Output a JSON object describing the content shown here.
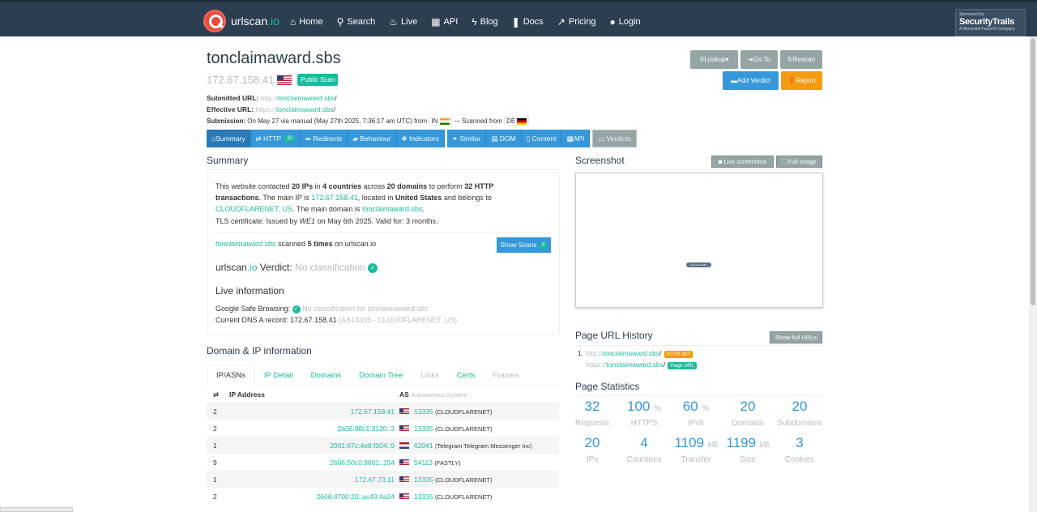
{
  "nav": {
    "brand_name": "urlscan",
    "brand_tld": ".io",
    "items": [
      {
        "label": "Home",
        "icon": "home-icon"
      },
      {
        "label": "Search",
        "icon": "search-icon"
      },
      {
        "label": "Live",
        "icon": "flame-icon"
      },
      {
        "label": "API",
        "icon": "api-icon"
      },
      {
        "label": "Blog",
        "icon": "bolt-icon"
      },
      {
        "label": "Docs",
        "icon": "bookmark-icon"
      },
      {
        "label": "Pricing",
        "icon": "external-link-icon"
      },
      {
        "label": "Login",
        "icon": "user-icon"
      }
    ],
    "sponsor_small": "Sponsored by",
    "sponsor_name": "SecurityTrails",
    "sponsor_sub": "A Recorded Future® Company"
  },
  "header": {
    "domain": "tonclaimaward.sbs",
    "ip": "172.67.158.41",
    "public_badge": "Public Scan",
    "submitted_label": "Submitted URL:",
    "submitted_scheme": "http://",
    "submitted_host": "tonclaimaward.sbs",
    "submitted_path": "/",
    "effective_label": "Effective URL:",
    "effective_scheme": "https://",
    "effective_host": "tonclaimaward.sbs",
    "effective_path": "/",
    "submission_label": "Submission:",
    "submission_text": "On May 27 via manual (May 27th 2025, 7:36:17 am UTC) from",
    "submission_cc": "IN",
    "scanned_from_text": "— Scanned from",
    "scanned_cc": "DE"
  },
  "actions": {
    "lookup": "Lookup",
    "goto": "Go To",
    "rescan": "Rescan",
    "add_verdict": "Add Verdict",
    "report": "Report"
  },
  "tabs": {
    "summary": "Summary",
    "http": "HTTP",
    "http_count": "32",
    "redirects": "Redirects",
    "behaviour": "Behaviour",
    "indicators": "Indicators",
    "similar": "Similar",
    "dom": "DOM",
    "content": "Content",
    "api": "API",
    "verdicts": "Verdicts"
  },
  "summary": {
    "heading": "Summary",
    "t1": "This website contacted ",
    "ips": "20 IPs",
    "t2": " in ",
    "countries": "4 countries",
    "t3": " across ",
    "domains": "20 domains",
    "t4": " to perform ",
    "http_tx": "32 HTTP transactions",
    "t5": ". The main IP is ",
    "main_ip": "172.67.158.41",
    "t6": ", located in ",
    "location": "United States",
    "t7": " and belongs to ",
    "asn": "CLOUDFLARENET, US",
    "t8": ". The main domain is ",
    "main_domain": "tonclaimaward.sbs",
    "t9": ".",
    "tls_prefix": "TLS certificate: Issued by ",
    "tls_issuer": "WE1",
    "tls_suffix": " on May 6th 2025. Valid for: 3 months.",
    "scanned_domain": "tonclaimaward.sbs",
    "scanned_mid": " scanned ",
    "scanned_times": "5 times",
    "scanned_suffix": " on urlscan.io",
    "show_scans": "Show Scans",
    "show_scans_count": "5",
    "verdict_prefix": "urlscan",
    "verdict_tld": ".io",
    "verdict_label": " Verdict: ",
    "verdict_value": "No classification",
    "live_heading": "Live information",
    "gsb_label": "Google Safe Browsing: ",
    "gsb_value": "No classification for ",
    "gsb_domain": "tonclaimaward.sbs",
    "dns_label": "Current DNS A record: 172.67.158.41 ",
    "dns_as": "(AS13335 - CLOUDFLARENET, US)"
  },
  "domain_ip": {
    "heading": "Domain & IP information",
    "tabs": [
      "IP/ASNs",
      "IP Detail",
      "Domains",
      "Domain Tree",
      "Links",
      "Certs",
      "Frames"
    ],
    "col_ip": "IP Address",
    "col_as": "AS",
    "col_as_sub": "Autonomous System",
    "rows": [
      {
        "count": "2",
        "ip": "172.67.158.41",
        "flag": "US",
        "asn": "13335",
        "as_name": "(CLOUDFLARENET)"
      },
      {
        "count": "2",
        "ip": "2a06:98c1:3120::3",
        "flag": "US",
        "asn": "13335",
        "as_name": "(CLOUDFLARENET)"
      },
      {
        "count": "1",
        "ip": "2001:67c:4e8:f004::9",
        "flag": "NL",
        "asn": "62041",
        "as_name": "(Telegram Telegram Messenger Inc)"
      },
      {
        "count": "9",
        "ip": "2606:50c0:8001::154",
        "flag": "US",
        "asn": "54113",
        "as_name": "(FASTLY)"
      },
      {
        "count": "1",
        "ip": "172.67.73.11",
        "flag": "US",
        "asn": "13335",
        "as_name": "(CLOUDFLARENET)"
      },
      {
        "count": "2",
        "ip": "2606:4700:20::ac43:4a24",
        "flag": "US",
        "asn": "13335",
        "as_name": "(CLOUDFLARENET)"
      }
    ]
  },
  "screenshot": {
    "heading": "Screenshot",
    "live_btn": "Live screenshot",
    "full_btn": "Full Image",
    "inner_label": "Connect Wallet"
  },
  "history": {
    "heading": "Page URL History",
    "show_full": "Show full URLs",
    "items": [
      {
        "num": "1.",
        "scheme": "http://",
        "host": "tonclaimaward.sbs",
        "path": "/",
        "tag": "HTTP 307"
      },
      {
        "num": "",
        "scheme": "https://",
        "host": "tonclaimaward.sbs",
        "path": "/",
        "tag": "Page URL"
      }
    ]
  },
  "stats": {
    "heading": "Page Statistics",
    "items": [
      {
        "num": "32",
        "unit": "",
        "label": "Requests"
      },
      {
        "num": "100",
        "unit": "%",
        "label": "HTTPS"
      },
      {
        "num": "60",
        "unit": "%",
        "label": "IPv6"
      },
      {
        "num": "20",
        "unit": "",
        "label": "Domains"
      },
      {
        "num": "20",
        "unit": "",
        "label": "Subdomains"
      },
      {
        "num": "20",
        "unit": "",
        "label": "IPs"
      },
      {
        "num": "4",
        "unit": "",
        "label": "Countries"
      },
      {
        "num": "1109",
        "unit": "kB",
        "label": "Transfer"
      },
      {
        "num": "1199",
        "unit": "kB",
        "label": "Size"
      },
      {
        "num": "3",
        "unit": "",
        "label": "Cookies"
      }
    ]
  }
}
